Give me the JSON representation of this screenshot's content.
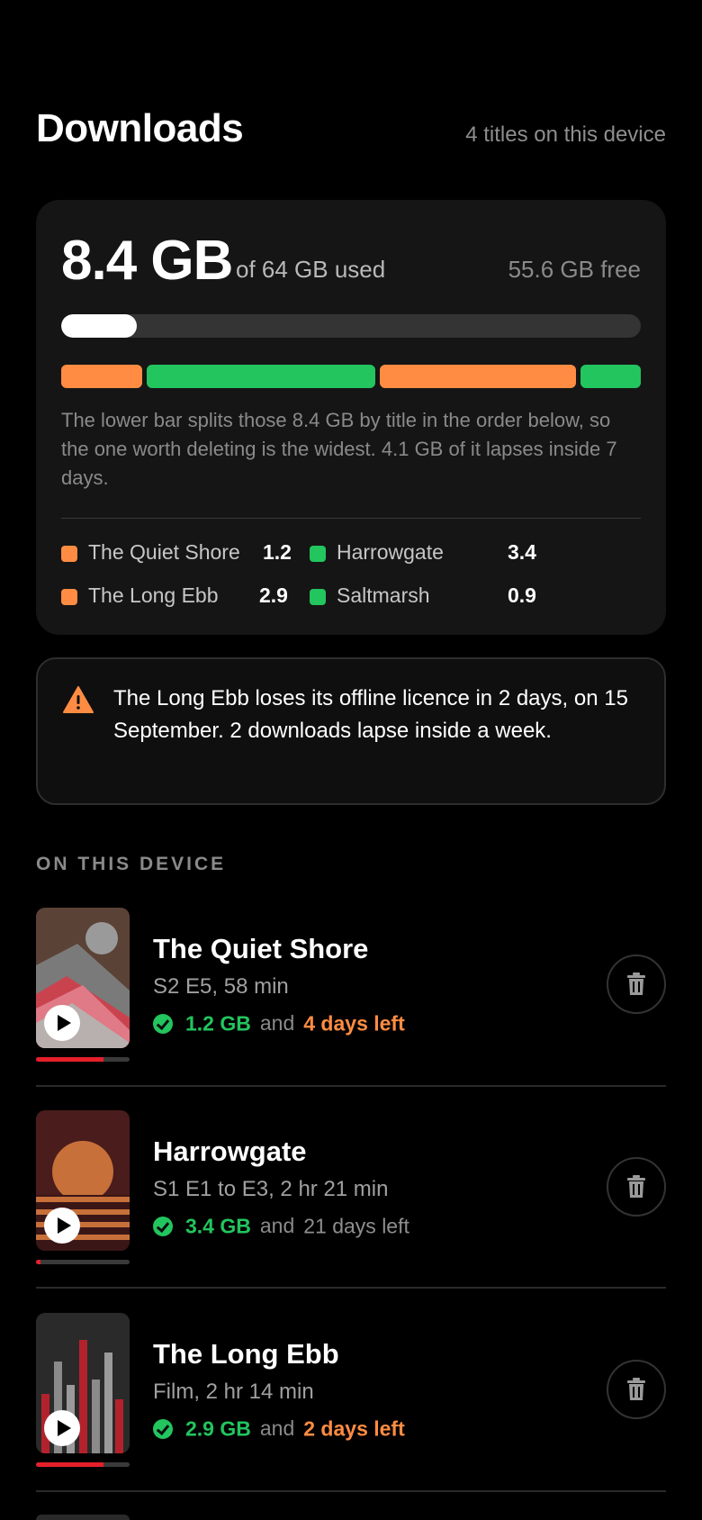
{
  "header": {
    "title": "Downloads",
    "count": "4 titles on this device"
  },
  "storage": {
    "used": "8.4 GB",
    "of_total": "of 64 GB used",
    "free": "55.6 GB free",
    "used_fraction": 0.131,
    "note": "The lower bar splits those 8.4 GB by title in the order below, so the one worth deleting is the widest. 4.1 GB of it lapses inside 7 days.",
    "segments": [
      {
        "name": "The Quiet Shore",
        "gb": 1.2,
        "color": "#ff8c42"
      },
      {
        "name": "Harrowgate",
        "gb": 3.4,
        "color": "#22c55e"
      },
      {
        "name": "The Long Ebb",
        "gb": 2.9,
        "color": "#ff8c42"
      },
      {
        "name": "Saltmarsh",
        "gb": 0.9,
        "color": "#22c55e"
      }
    ],
    "legend": [
      {
        "name": "The Quiet Shore",
        "value": "1.2"
      },
      {
        "name": "Harrowgate",
        "value": "3.4"
      },
      {
        "name": "The Long Ebb",
        "value": "2.9"
      },
      {
        "name": "Saltmarsh",
        "value": "0.9"
      }
    ]
  },
  "alert": {
    "icon": "warning-icon",
    "text": "The Long Ebb loses its offline licence in 2 days, on 15 September. 2 downloads lapse inside a week."
  },
  "section_label": "ON THIS DEVICE",
  "items": [
    {
      "title": "The Quiet Shore",
      "meta": "S2 E5, 58 min",
      "size": "1.2 GB",
      "and": "and",
      "left": "4 days left",
      "urgent": true,
      "watched": 0.72
    },
    {
      "title": "Harrowgate",
      "meta": "S1 E1 to E3, 2 hr 21 min",
      "size": "3.4 GB",
      "and": "and",
      "left": "21 days left",
      "urgent": false,
      "watched": 0.05
    },
    {
      "title": "The Long Ebb",
      "meta": "Film, 2 hr 14 min",
      "size": "2.9 GB",
      "and": "and",
      "left": "2 days left",
      "urgent": true,
      "watched": 0.72
    }
  ],
  "colors": {
    "accent_orange": "#ff8c42",
    "accent_green": "#22c55e",
    "watched_red": "#e5202a"
  }
}
